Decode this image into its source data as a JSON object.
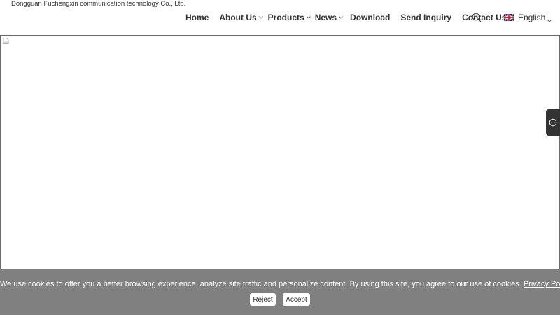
{
  "header": {
    "company_name": "Dongguan Fuchengxin communication technology Co., Ltd.",
    "nav": [
      {
        "label": "Home",
        "dropdown": false
      },
      {
        "label": "About Us",
        "dropdown": true
      },
      {
        "label": "Products",
        "dropdown": true
      },
      {
        "label": "News",
        "dropdown": true
      },
      {
        "label": "Download",
        "dropdown": false
      },
      {
        "label": "Send Inquiry",
        "dropdown": false
      },
      {
        "label": "Contact Us",
        "dropdown": false
      }
    ],
    "search_icon": "search-icon",
    "language": {
      "flag": "uk-flag-icon",
      "label": "English"
    }
  },
  "side_widget": {
    "icon": "chat-icon"
  },
  "cookie_bar": {
    "message": "We use cookies to offer you a better browsing experience, analyze site traffic and personalize content. By using this site, you agree to our use of cookies.",
    "policy_link": "Privacy Policy",
    "reject_label": "Reject",
    "accept_label": "Accept",
    "background": "#808080"
  }
}
